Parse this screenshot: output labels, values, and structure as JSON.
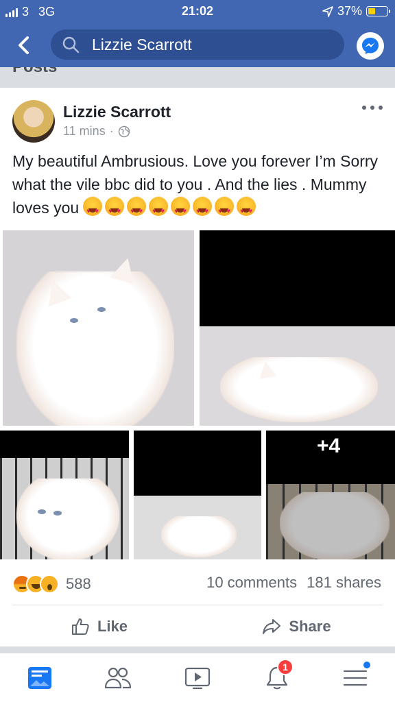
{
  "status_bar": {
    "carrier": "3",
    "network": "3G",
    "time": "21:02",
    "battery": "37%",
    "battery_level": 0.37
  },
  "header": {
    "search_text": "Lizzie Scarrott",
    "back_icon": "chevron-left-icon",
    "messenger_icon": "messenger-icon"
  },
  "section": {
    "title": "Posts"
  },
  "post": {
    "author": "Lizzie Scarrott",
    "time": "11 mins",
    "separator": "·",
    "privacy_icon": "globe-icon",
    "text": "My beautiful Ambrusious. Love you forever I’m Sorry what the vile bbc did to you . And the lies . Mummy loves you",
    "emoji_count": 8,
    "photos": [
      {
        "label": "kitten-sitting"
      },
      {
        "label": "kitten-sleeping"
      },
      {
        "label": "kitten-in-crate"
      },
      {
        "label": "kitten-lying"
      },
      {
        "label": "kitten-more",
        "overlay": "+4"
      }
    ],
    "reactions_count": "588",
    "comments": "10 comments",
    "shares": "181 shares",
    "like_label": "Like",
    "share_label": "Share"
  },
  "tabbar": {
    "notifications_badge": "1",
    "items": [
      "news-feed-icon",
      "friends-icon",
      "watch-icon",
      "notifications-icon",
      "menu-icon"
    ]
  },
  "colors": {
    "brand": "#4267b2",
    "badge": "#fa3e3e"
  }
}
